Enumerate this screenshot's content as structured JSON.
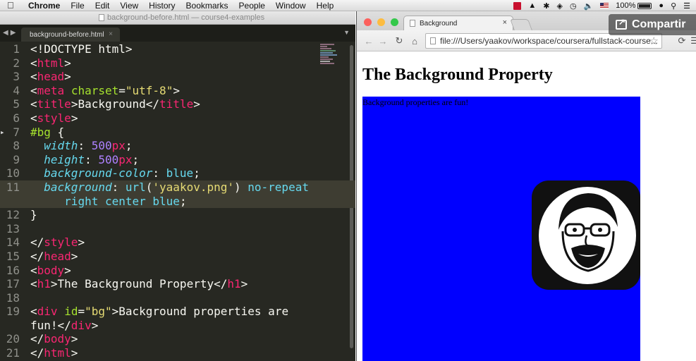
{
  "menubar": {
    "apple": "",
    "app": "Chrome",
    "items": [
      "File",
      "Edit",
      "View",
      "History",
      "Bookmarks",
      "People",
      "Window",
      "Help"
    ],
    "battery": "100%"
  },
  "editor": {
    "window_title": "background-before.html — course4-examples",
    "tab_label": "background-before.html",
    "tab_close": "×",
    "lines": [
      {
        "n": "1",
        "segs": [
          [
            "w",
            "<!DOCTYPE html>"
          ]
        ]
      },
      {
        "n": "2",
        "segs": [
          [
            "w",
            "<"
          ],
          [
            "tag",
            "html"
          ],
          [
            "w",
            ">"
          ]
        ]
      },
      {
        "n": "3",
        "segs": [
          [
            "w",
            "<"
          ],
          [
            "tag",
            "head"
          ],
          [
            "w",
            ">"
          ]
        ]
      },
      {
        "n": "4",
        "segs": [
          [
            "w",
            "<"
          ],
          [
            "tag",
            "meta"
          ],
          [
            "w",
            " "
          ],
          [
            "attr",
            "charset"
          ],
          [
            "w",
            "="
          ],
          [
            "str",
            "\"utf-8\""
          ],
          [
            "w",
            ">"
          ]
        ]
      },
      {
        "n": "5",
        "segs": [
          [
            "w",
            "<"
          ],
          [
            "tag",
            "title"
          ],
          [
            "w",
            ">Background</"
          ],
          [
            "tag",
            "title"
          ],
          [
            "w",
            ">"
          ]
        ]
      },
      {
        "n": "6",
        "segs": [
          [
            "w",
            "<"
          ],
          [
            "tag",
            "style"
          ],
          [
            "w",
            ">"
          ]
        ]
      },
      {
        "n": "7",
        "segs": [
          [
            "sel",
            "#bg"
          ],
          [
            "w",
            " {"
          ]
        ]
      },
      {
        "n": "8",
        "segs": [
          [
            "w",
            "  "
          ],
          [
            "prop",
            "width"
          ],
          [
            "w",
            ": "
          ],
          [
            "num",
            "500"
          ],
          [
            "unit",
            "px"
          ],
          [
            "w",
            ";"
          ]
        ]
      },
      {
        "n": "9",
        "segs": [
          [
            "w",
            "  "
          ],
          [
            "prop",
            "height"
          ],
          [
            "w",
            ": "
          ],
          [
            "num",
            "500"
          ],
          [
            "unit",
            "px"
          ],
          [
            "w",
            ";"
          ]
        ]
      },
      {
        "n": "10",
        "segs": [
          [
            "w",
            "  "
          ],
          [
            "prop",
            "background-color"
          ],
          [
            "w",
            ": "
          ],
          [
            "val",
            "blue"
          ],
          [
            "w",
            ";"
          ]
        ]
      },
      {
        "n": "11",
        "segs": [
          [
            "w",
            "  "
          ],
          [
            "prop",
            "background"
          ],
          [
            "w",
            ": "
          ],
          [
            "val",
            "url"
          ],
          [
            "w",
            "("
          ],
          [
            "str",
            "'yaakov.png'"
          ],
          [
            "w",
            ") "
          ],
          [
            "val",
            "no-repeat"
          ]
        ]
      },
      {
        "n": "",
        "segs": [
          [
            "w",
            "     "
          ],
          [
            "val",
            "right center blue"
          ],
          [
            "w",
            ";"
          ]
        ]
      },
      {
        "n": "12",
        "segs": [
          [
            "w",
            "}"
          ]
        ]
      },
      {
        "n": "13",
        "segs": []
      },
      {
        "n": "14",
        "segs": [
          [
            "w",
            "</"
          ],
          [
            "tag",
            "style"
          ],
          [
            "w",
            ">"
          ]
        ]
      },
      {
        "n": "15",
        "segs": [
          [
            "w",
            "</"
          ],
          [
            "tag",
            "head"
          ],
          [
            "w",
            ">"
          ]
        ]
      },
      {
        "n": "16",
        "segs": [
          [
            "w",
            "<"
          ],
          [
            "tag",
            "body"
          ],
          [
            "w",
            ">"
          ]
        ]
      },
      {
        "n": "17",
        "segs": [
          [
            "w",
            "<"
          ],
          [
            "tag",
            "h1"
          ],
          [
            "w",
            ">The Background Property</"
          ],
          [
            "tag",
            "h1"
          ],
          [
            "w",
            ">"
          ]
        ]
      },
      {
        "n": "18",
        "segs": []
      },
      {
        "n": "19",
        "segs": [
          [
            "w",
            "<"
          ],
          [
            "tag",
            "div"
          ],
          [
            "w",
            " "
          ],
          [
            "attr",
            "id"
          ],
          [
            "w",
            "="
          ],
          [
            "str",
            "\"bg\""
          ],
          [
            "w",
            ">Background properties are"
          ]
        ]
      },
      {
        "n": "",
        "segs": [
          [
            "w",
            "fun!</"
          ],
          [
            "tag",
            "div"
          ],
          [
            "w",
            ">"
          ]
        ]
      },
      {
        "n": "20",
        "segs": [
          [
            "w",
            "</"
          ],
          [
            "tag",
            "body"
          ],
          [
            "w",
            ">"
          ]
        ]
      },
      {
        "n": "21",
        "segs": [
          [
            "w",
            "</"
          ],
          [
            "tag",
            "html"
          ],
          [
            "w",
            ">"
          ]
        ]
      }
    ]
  },
  "browser": {
    "tab_title": "Background",
    "tab_close": "×",
    "url": "file:///Users/yaakov/workspace/coursera/fullstack-course...",
    "share_label": "Compartir",
    "page": {
      "heading": "The Background Property",
      "div_text": "Background properties are fun!"
    },
    "colors": {
      "bg_div": "#0000ff"
    }
  }
}
